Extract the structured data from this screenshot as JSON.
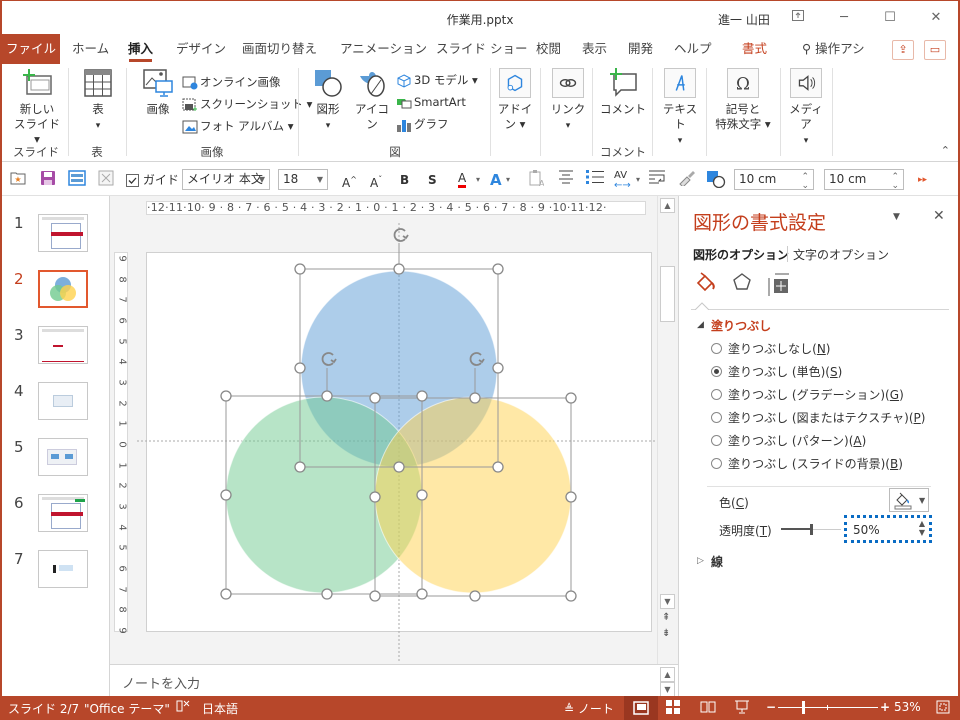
{
  "window": {
    "title": "作業用.pptx",
    "user": "進一 山田",
    "controls": [
      "ribbon-display-options",
      "minimize",
      "maximize",
      "close"
    ]
  },
  "tabs": [
    {
      "label": "ファイル",
      "id": "file"
    },
    {
      "label": "ホーム",
      "id": "home"
    },
    {
      "label": "挿入",
      "id": "insert",
      "active": true
    },
    {
      "label": "デザイン",
      "id": "design"
    },
    {
      "label": "画面切り替え",
      "id": "transitions"
    },
    {
      "label": "アニメーション",
      "id": "animations"
    },
    {
      "label": "スライド ショー",
      "id": "slideshow"
    },
    {
      "label": "校閲",
      "id": "review"
    },
    {
      "label": "表示",
      "id": "view"
    },
    {
      "label": "開発",
      "id": "developer"
    },
    {
      "label": "ヘルプ",
      "id": "help"
    },
    {
      "label": "書式",
      "id": "format"
    }
  ],
  "search": {
    "label": "操作アシ"
  },
  "ribbon": {
    "new_slide": {
      "line1": "新しい",
      "line2": "スライド ▾"
    },
    "table": {
      "label": "表",
      "arrow": "▾"
    },
    "image": {
      "label": "画像"
    },
    "online_image": "オンライン画像",
    "screenshot": "スクリーンショット ▾",
    "photo_album": "フォト アルバム ▾",
    "shapes": {
      "label": "図形",
      "arrow": "▾"
    },
    "icons": "アイコン",
    "model3d": "3D モデル ▾",
    "smartart": "SmartArt",
    "chart": "グラフ",
    "addin": {
      "line1": "アドイ",
      "line2": "ン ▾"
    },
    "link": {
      "label": "リンク",
      "arrow": "▾"
    },
    "comment": "コメント",
    "text": {
      "label": "テキスト",
      "arrow": "▾"
    },
    "symbols": {
      "line1": "記号と",
      "line2": "特殊文字 ▾"
    },
    "media": {
      "label": "メディア",
      "arrow": "▾"
    },
    "groups": {
      "slides": "スライド",
      "tables": "表",
      "images": "画像",
      "illustrations": "図",
      "comments": "コメント"
    }
  },
  "qat": {
    "guide_label": "ガイド",
    "guide_checked": true,
    "font": "メイリオ 本文",
    "font_size": "18",
    "width": "10 cm",
    "height": "10 cm"
  },
  "thumbnails": [
    {
      "num": "1"
    },
    {
      "num": "2",
      "current": true
    },
    {
      "num": "3"
    },
    {
      "num": "4"
    },
    {
      "num": "5"
    },
    {
      "num": "6"
    },
    {
      "num": "7"
    }
  ],
  "ruler": {
    "horizontal": "·12·11·10· 9 · 8 · 7 · 6 · 5 · 4 · 3 · 2 · 1 · 0 · 1 · 2 · 3 · 4 · 5 · 6 · 7 · 8 · 9 ·10·11·12·",
    "vertical": [
      "9",
      "8",
      "7",
      "6",
      "5",
      "4",
      "3",
      "2",
      "1",
      "0",
      "1",
      "2",
      "3",
      "4",
      "5",
      "6",
      "7",
      "8",
      "9"
    ]
  },
  "slide": {
    "circles": [
      {
        "name": "blue-circle",
        "color": "#5b9bd5",
        "opacity": 0.5
      },
      {
        "name": "green-circle",
        "color": "#70ca8f",
        "opacity": 0.5
      },
      {
        "name": "yellow-circle",
        "color": "#ffd24d",
        "opacity": 0.5
      }
    ]
  },
  "notes": {
    "placeholder": "ノートを入力"
  },
  "pane": {
    "title": "図形の書式設定",
    "tab_shape": "図形のオプション",
    "tab_text": "文字のオプション",
    "fill_section": "塗りつぶし",
    "fill_options": [
      {
        "label": "塗りつぶしなし(",
        "key": "N",
        "checked": false
      },
      {
        "label": "塗りつぶし (単色)(",
        "key": "S",
        "checked": true
      },
      {
        "label": "塗りつぶし (グラデーション)(",
        "key": "G",
        "checked": false
      },
      {
        "label": "塗りつぶし (図またはテクスチャ)(",
        "key": "P",
        "checked": false
      },
      {
        "label": "塗りつぶし (パターン)(",
        "key": "A",
        "checked": false
      },
      {
        "label": "塗りつぶし (スライドの背景)(",
        "key": "B",
        "checked": false
      }
    ],
    "color_label": "色(",
    "color_key": "C",
    "transparency_label": "透明度(",
    "transparency_key": "T",
    "transparency_value": "50%",
    "transparency_fraction": 0.5,
    "line_section": "線"
  },
  "status": {
    "slide": "スライド 2/7",
    "theme": "\"Office テーマ\"",
    "language": "日本語",
    "notes": "ノート",
    "zoom": "53%",
    "zoom_fraction": 0.53
  },
  "colors": {
    "accent": "#b7472a",
    "accent_text": "#c43e1c",
    "focus": "#0a6cc4"
  }
}
